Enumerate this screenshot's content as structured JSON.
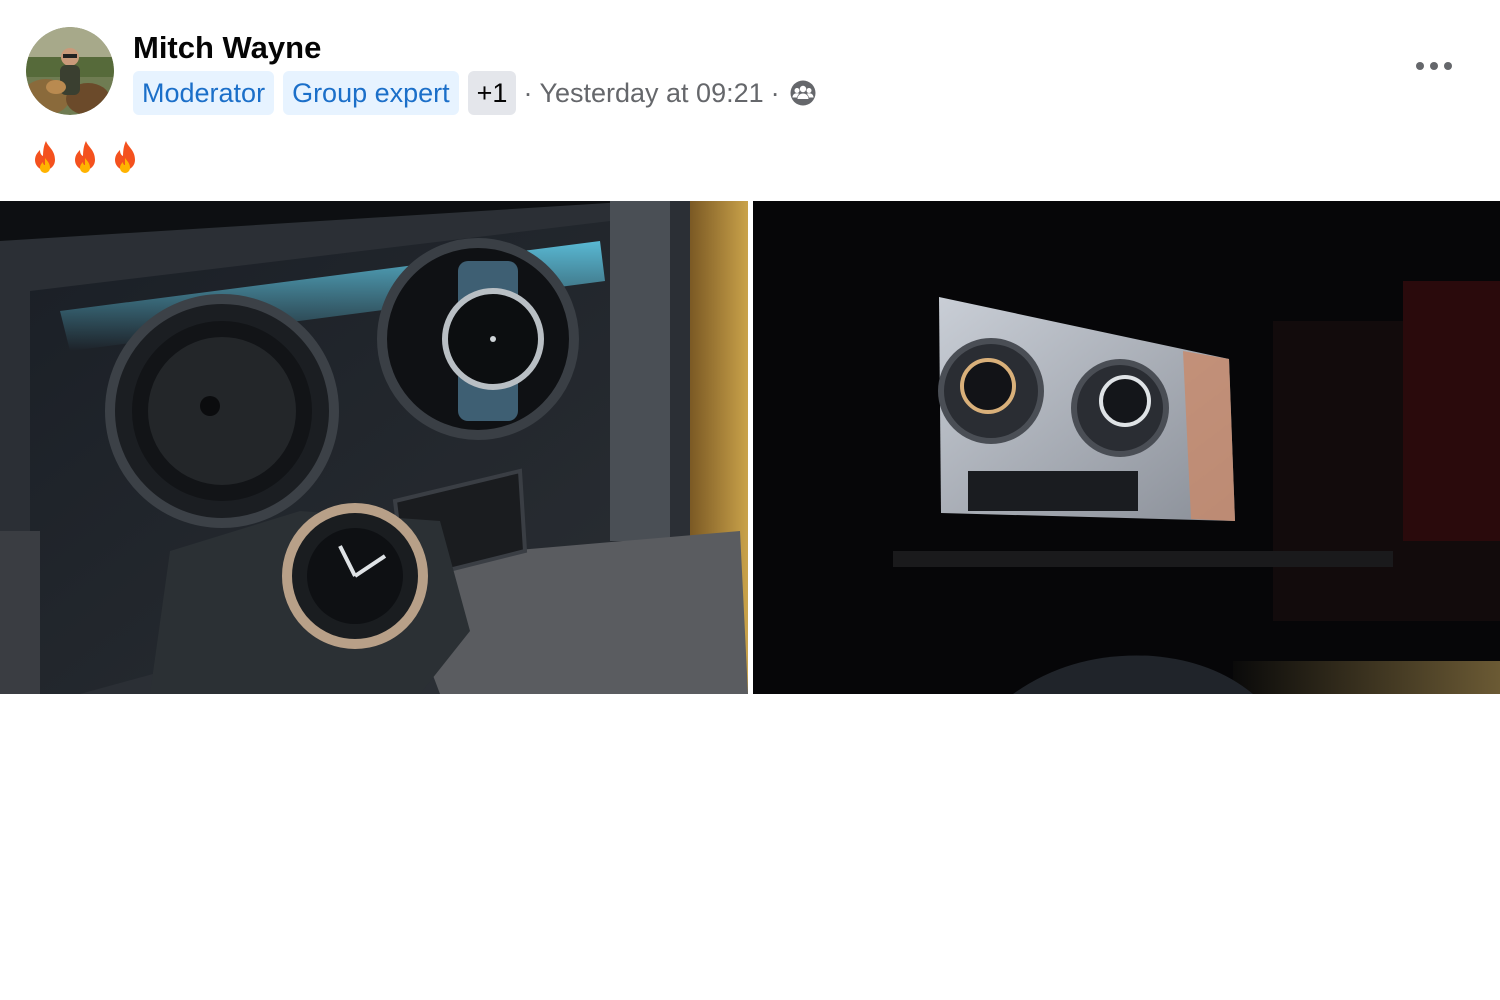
{
  "post": {
    "author": {
      "name": "Mitch Wayne",
      "avatar_icon": "user-photo"
    },
    "badges": [
      "Moderator",
      "Group expert"
    ],
    "badge_more": "+1",
    "separator": "·",
    "timestamp": "Yesterday at 09:21",
    "audience_icon": "group-members-icon",
    "more_icon": "more-options-icon",
    "text_icons": [
      "fire-emoji",
      "fire-emoji",
      "fire-emoji"
    ],
    "photos": [
      {
        "icon": "watch-winder-photo"
      },
      {
        "icon": "watch-winder-photo"
      }
    ]
  },
  "colors": {
    "badge_bg": "#e7f3ff",
    "badge_text": "#1b6fc9",
    "secondary_text": "#65676b",
    "primary_text": "#050505"
  }
}
